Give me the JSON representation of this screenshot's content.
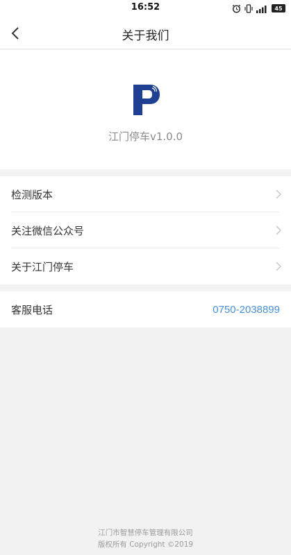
{
  "status_bar": {
    "time": "16:52",
    "battery": "45",
    "icons": [
      "alarm-icon",
      "vibrate-icon",
      "signal-icon"
    ]
  },
  "nav": {
    "title": "关于我们",
    "back_icon": "chevron-left-icon"
  },
  "app": {
    "logo_icon": "parking-p-logo",
    "version_text": "江门停车v1.0.0"
  },
  "menu": {
    "items": [
      {
        "label": "检测版本"
      },
      {
        "label": "关注微信公众号"
      },
      {
        "label": "关于江门停车"
      }
    ]
  },
  "contact": {
    "label": "客服电话",
    "phone": "0750-2038899"
  },
  "footer": {
    "company": "江门市智慧停车管理有限公司",
    "copyright": "版权所有 Copyright ©2019"
  },
  "colors": {
    "brand_blue": "#1f3f92",
    "link_blue": "#4a90d9",
    "background": "#f2f2f2"
  }
}
